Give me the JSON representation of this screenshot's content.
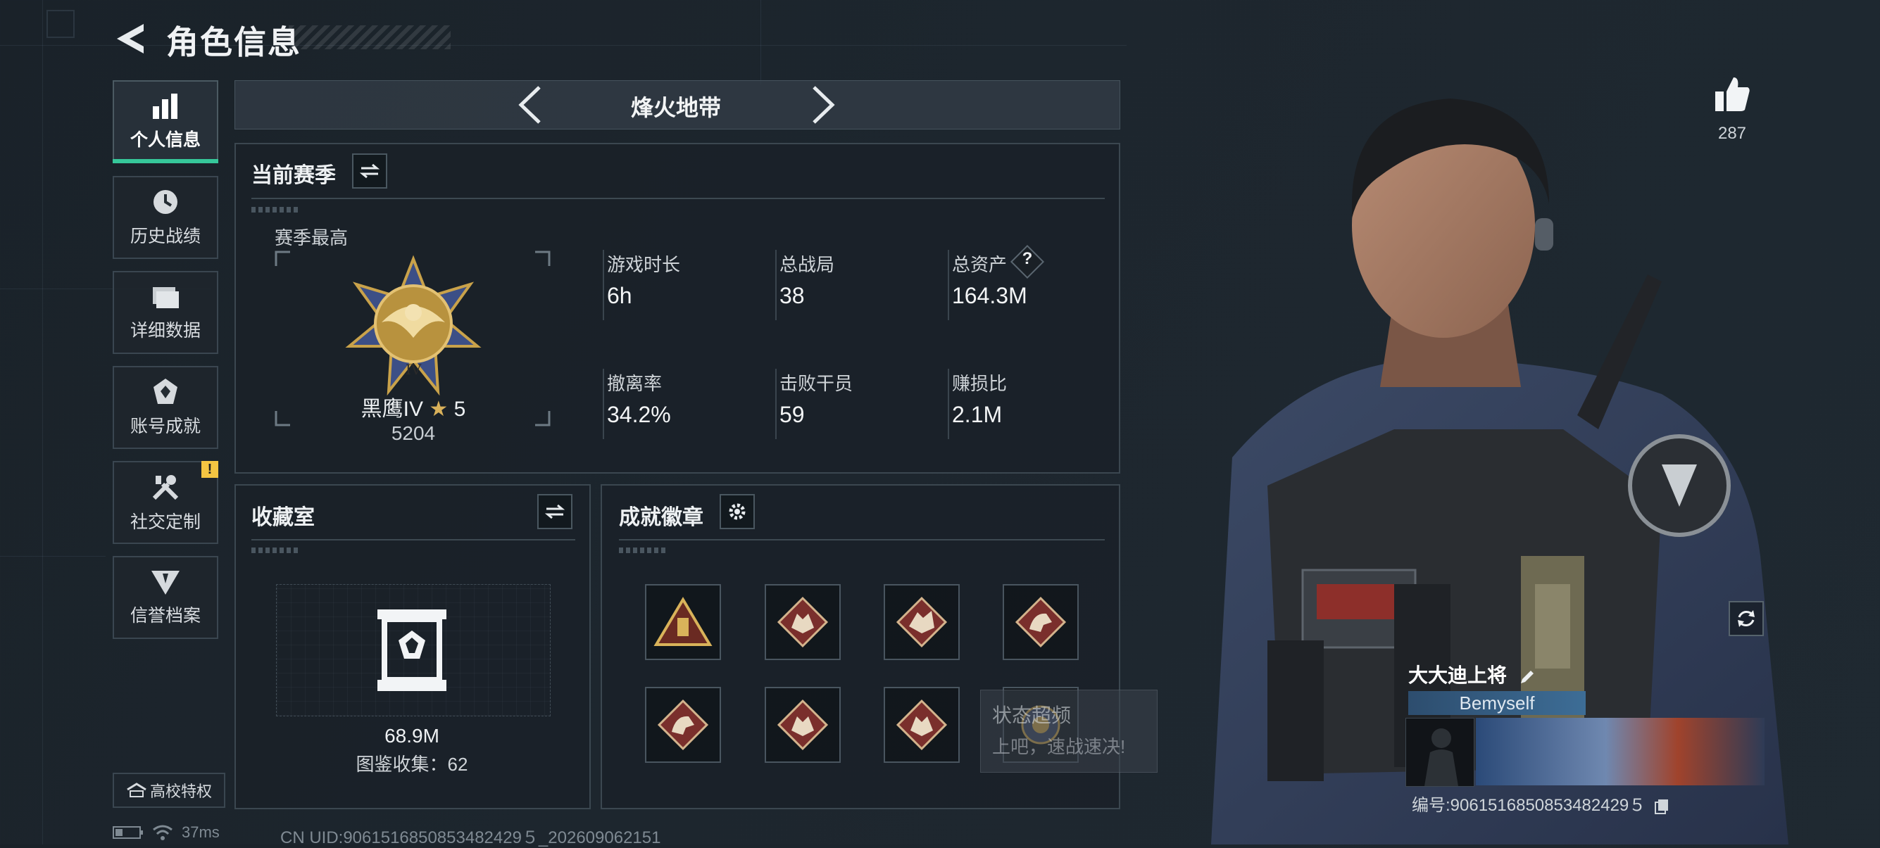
{
  "header": {
    "title": "角色信息"
  },
  "sidebar": {
    "items": [
      {
        "label": "个人信息",
        "icon": "bar-chart-icon",
        "active": true
      },
      {
        "label": "历史战绩",
        "icon": "clock-icon"
      },
      {
        "label": "详细数据",
        "icon": "folder-icon"
      },
      {
        "label": "账号成就",
        "icon": "achievement-icon"
      },
      {
        "label": "社交定制",
        "icon": "tools-icon",
        "badge": "!"
      },
      {
        "label": "信誉档案",
        "icon": "reputation-icon"
      }
    ],
    "campus_button": "高校特权"
  },
  "mode": {
    "title": "烽火地带"
  },
  "season": {
    "title": "当前赛季",
    "best_label": "赛季最高",
    "rank_name": "黑鹰IV",
    "rank_stars": "5",
    "rank_score": "5204",
    "stats": [
      {
        "label": "游戏时长",
        "value": "6h"
      },
      {
        "label": "总战局",
        "value": "38"
      },
      {
        "label": "总资产",
        "value": "164.3M",
        "help": "?"
      },
      {
        "label": "撤离率",
        "value": "34.2%"
      },
      {
        "label": "击败干员",
        "value": "59"
      },
      {
        "label": "赚损比",
        "value": "2.1M"
      }
    ]
  },
  "collection": {
    "title": "收藏室",
    "value": "68.9M",
    "catalog": "图鉴收集：62"
  },
  "achievements": {
    "title": "成就徽章"
  },
  "toast": {
    "line1": "状态超频",
    "line2": "上吧，速战速决!"
  },
  "profile": {
    "likes": "287",
    "name": "大大迪上将",
    "tag": "Bemyself",
    "id": "编号:9061516850853482429５"
  },
  "status": {
    "ping": "37ms",
    "uid": "CN UID:9061516850853482429５_202609062151"
  },
  "colors": {
    "accent": "#36c79a",
    "badge_red": "#7a2f2c",
    "gold": "#c9a24a"
  }
}
